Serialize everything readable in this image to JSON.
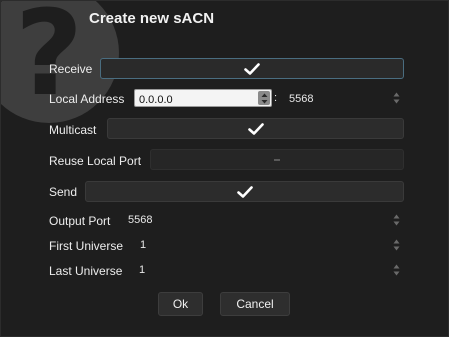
{
  "dialog": {
    "title": "Create new sACN"
  },
  "fields": {
    "receive": {
      "label": "Receive",
      "checked": true
    },
    "local_address": {
      "label": "Local Address",
      "ip_value": "0.0.0.0",
      "separator": ":",
      "port": "5568"
    },
    "multicast": {
      "label": "Multicast",
      "checked": true
    },
    "reuse_local_port": {
      "label": "Reuse Local Port",
      "checked": false,
      "enabled": false
    },
    "send": {
      "label": "Send",
      "checked": true
    },
    "output_port": {
      "label": "Output Port",
      "value": "5568"
    },
    "first_universe": {
      "label": "First Universe",
      "value": "1"
    },
    "last_universe": {
      "label": "Last Universe",
      "value": "1"
    }
  },
  "buttons": {
    "ok": "Ok",
    "cancel": "Cancel"
  },
  "icons": {
    "help": "help-question-icon",
    "check": "checkmark-icon",
    "spin": "spin-arrows-icon"
  },
  "colors": {
    "background": "#1e1e1e",
    "focus_border": "#4a6d80"
  }
}
